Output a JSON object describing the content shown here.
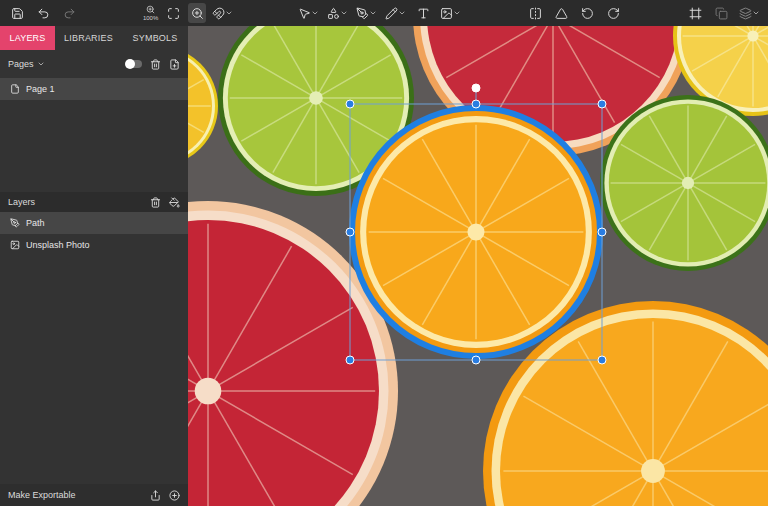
{
  "toolbar": {
    "zoom": "100%"
  },
  "tabs": [
    {
      "label": "LAYERS",
      "selected": true
    },
    {
      "label": "LIBRARIES",
      "selected": false
    },
    {
      "label": "SYMBOLS",
      "selected": false
    }
  ],
  "pages": {
    "header": "Pages",
    "toggle_on": false,
    "items": [
      {
        "label": "Page 1",
        "selected": true
      }
    ]
  },
  "layers": {
    "header": "Layers",
    "items": [
      {
        "label": "Path",
        "kind": "path",
        "selected": true
      },
      {
        "label": "Unsplash Photo",
        "kind": "image",
        "selected": false
      }
    ]
  },
  "footer": {
    "label": "Make Exportable"
  }
}
